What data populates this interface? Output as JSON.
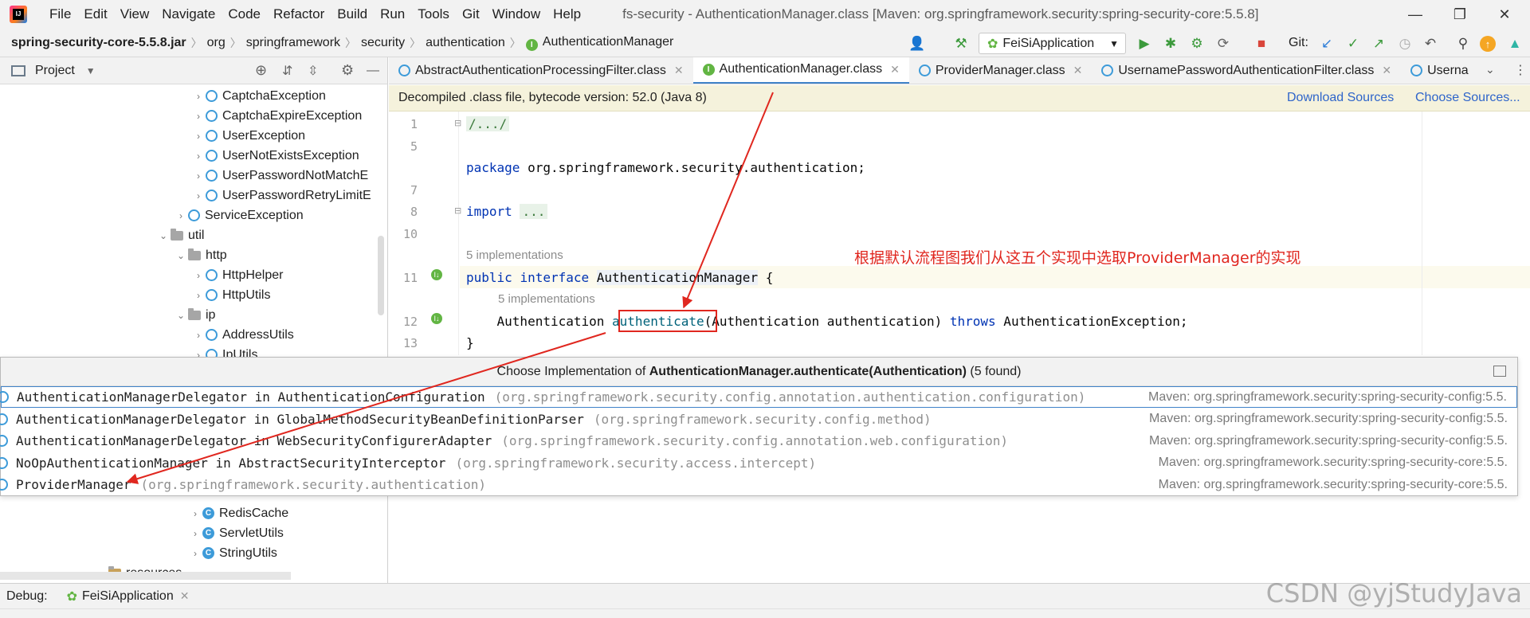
{
  "menubar": {
    "items": [
      "File",
      "Edit",
      "View",
      "Navigate",
      "Code",
      "Refactor",
      "Build",
      "Run",
      "Tools",
      "Git",
      "Window",
      "Help"
    ],
    "title": "fs-security - AuthenticationManager.class [Maven: org.springframework.security:spring-security-core:5.5.8]"
  },
  "navbar": {
    "jar": "spring-security-core-5.5.8.jar",
    "crumbs": [
      "org",
      "springframework",
      "security",
      "authentication"
    ],
    "current": "AuthenticationManager",
    "run_config": "FeiSiApplication",
    "git_label": "Git:"
  },
  "project": {
    "title": "Project",
    "rows": [
      {
        "label": "CaptchaException",
        "kind": "class"
      },
      {
        "label": "CaptchaExpireException",
        "kind": "class"
      },
      {
        "label": "UserException",
        "kind": "class"
      },
      {
        "label": "UserNotExistsException",
        "kind": "class"
      },
      {
        "label": "UserPasswordNotMatchE",
        "kind": "class"
      },
      {
        "label": "UserPasswordRetryLimitE",
        "kind": "class"
      },
      {
        "label": "ServiceException",
        "kind": "class"
      },
      {
        "label": "util",
        "kind": "folder"
      },
      {
        "label": "http",
        "kind": "folder"
      },
      {
        "label": "HttpHelper",
        "kind": "class"
      },
      {
        "label": "HttpUtils",
        "kind": "class"
      },
      {
        "label": "ip",
        "kind": "folder"
      },
      {
        "label": "AddressUtils",
        "kind": "class"
      },
      {
        "label": "IpUtils",
        "kind": "class"
      }
    ],
    "lower_rows": [
      {
        "label": "RedisCache",
        "kind": "class"
      },
      {
        "label": "ServletUtils",
        "kind": "class"
      },
      {
        "label": "StringUtils",
        "kind": "class"
      },
      {
        "label": "resources",
        "kind": "folder"
      }
    ]
  },
  "tabs": [
    {
      "label": "AbstractAuthenticationProcessingFilter.class",
      "icon": "class-icon",
      "active": false
    },
    {
      "label": "AuthenticationManager.class",
      "icon": "interface-icon",
      "active": true
    },
    {
      "label": "ProviderManager.class",
      "icon": "class-icon",
      "active": false
    },
    {
      "label": "UsernamePasswordAuthenticationFilter.class",
      "icon": "class-icon",
      "active": false
    },
    {
      "label": "Userna",
      "icon": "class-icon",
      "active": false
    }
  ],
  "banner": {
    "text": "Decompiled .class file, bytecode version: 52.0 (Java 8)",
    "download_sources": "Download Sources",
    "choose_sources": "Choose Sources..."
  },
  "editor": {
    "line_numbers": [
      "1",
      "5",
      "7",
      "8",
      "10",
      "11",
      "12",
      "13"
    ],
    "line1": "/.../",
    "line5_kw": "package",
    "line5_rest": " org.springframework.security.authentication;",
    "line8_kw": "import",
    "line8_fold": "...",
    "hint_interface": "5 implementations",
    "line11_kw1": "public",
    "line11_kw2": "interface",
    "line11_name": "AuthenticationManager",
    "line11_brace": " {",
    "hint_method": "5 implementations",
    "line12_type": "    Authentication ",
    "line12_method": "authenticate",
    "line12_params": "(Authentication authentication) ",
    "line12_throws": "throws",
    "line12_exc": " AuthenticationException;",
    "line13": "}"
  },
  "annotation": "根据默认流程图我们从这五个实现中选取ProviderManager的实现",
  "popup": {
    "title_prefix": "Choose Implementation of ",
    "title_method": "AuthenticationManager.authenticate(Authentication)",
    "title_suffix": " (5 found)",
    "rows": [
      {
        "name": "AuthenticationManagerDelegator in AuthenticationConfiguration",
        "pkg": "(org.springframework.security.config.annotation.authentication.configuration)",
        "src": "Maven: org.springframework.security:spring-security-config:5.5.",
        "selected": true
      },
      {
        "name": "AuthenticationManagerDelegator in GlobalMethodSecurityBeanDefinitionParser",
        "pkg": "(org.springframework.security.config.method)",
        "src": "Maven: org.springframework.security:spring-security-config:5.5.",
        "selected": false
      },
      {
        "name": "AuthenticationManagerDelegator in WebSecurityConfigurerAdapter",
        "pkg": "(org.springframework.security.config.annotation.web.configuration)",
        "src": "Maven: org.springframework.security:spring-security-config:5.5.",
        "selected": false
      },
      {
        "name": "NoOpAuthenticationManager in AbstractSecurityInterceptor",
        "pkg": "(org.springframework.security.access.intercept)",
        "src": "Maven: org.springframework.security:spring-security-core:5.5.",
        "selected": false
      },
      {
        "name": "ProviderManager",
        "pkg": "(org.springframework.security.authentication)",
        "src": "Maven: org.springframework.security:spring-security-core:5.5.",
        "selected": false
      }
    ]
  },
  "debug": {
    "label": "Debug:",
    "tab": "FeiSiApplication"
  },
  "watermark": "CSDN @yjStudyJava",
  "colors": {
    "annotation_red": "#e0271f",
    "accent_blue": "#4083c9",
    "keyword_blue": "#0033b3"
  }
}
